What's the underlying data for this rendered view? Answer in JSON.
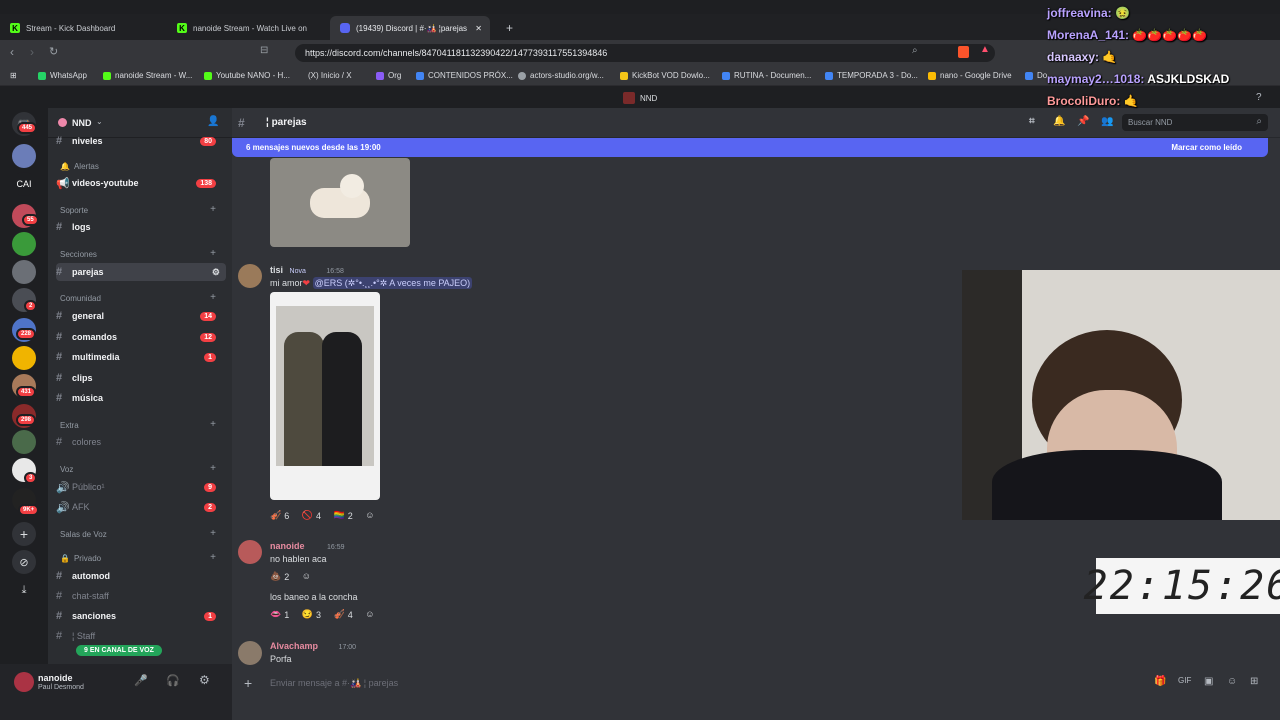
{
  "browser": {
    "tabs": [
      {
        "title": "Stream - Kick Dashboard"
      },
      {
        "title": "nanoide Stream - Watch Live on"
      },
      {
        "title": "(19439) Discord | #·🎎 ¦parejas"
      }
    ],
    "url": "https://discord.com/channels/847041181132390422/1477393117551394846",
    "bookmarks": [
      "WhatsApp",
      "nanoide Stream - W...",
      "Youtube NANO - H...",
      "(X) Inicio / X",
      "Org",
      "CONTENIDOS PRÓX...",
      "actors-studio.org/w...",
      "KickBot VOD Dowlo...",
      "RUTINA - Documen...",
      "TEMPORADA 3 - Do...",
      "nano - Google Drive",
      "Do..."
    ]
  },
  "top_strip": {
    "label": "NND"
  },
  "server_badges": {
    "first": "445",
    "b65": "55",
    "b2": "2",
    "b228": "228",
    "b431": "431",
    "b298": "298",
    "b3": "3",
    "b9k": "9K+",
    "cai": "CAI"
  },
  "guild": {
    "name": "NND",
    "search_placeholder": "Buscar NND"
  },
  "channels": {
    "niveles": {
      "name": "niveles",
      "badge": "80"
    },
    "alertas": "Alertas",
    "videos": {
      "name": "videos-youtube",
      "badge": "138"
    },
    "soporte": "Soporte",
    "logs": "logs",
    "secciones": "Secciones",
    "parejas": "parejas",
    "comunidad": "Comunidad",
    "general": {
      "name": "general",
      "badge": "14"
    },
    "comandos": {
      "name": "comandos",
      "badge": "12"
    },
    "multimedia": {
      "name": "multimedia",
      "badge": "1"
    },
    "clips": "clips",
    "musica": "música",
    "extra": "Extra",
    "colores": "colores",
    "voz": "Voz",
    "publico": {
      "name": "Público¹",
      "badge": "9"
    },
    "afk": {
      "name": "AFK",
      "badge": "2"
    },
    "salas": "Salas de Voz",
    "privado": "Privado",
    "automod": "automod",
    "chatstaff": "chat-staff",
    "sanciones": {
      "name": "sanciones",
      "badge": "1"
    },
    "staff": "¦ Staff",
    "voice_pill": "9 EN CANAL DE VOZ"
  },
  "user": {
    "name": "nanoide",
    "status": "Paul Desmond"
  },
  "header": {
    "channel": "¦ parejas"
  },
  "newbar": {
    "text": "6 mensajes nuevos desde las 19:00",
    "action": "Marcar como leído"
  },
  "messages": [
    {
      "author": "tisi",
      "tag": "Nova",
      "time": "16:58",
      "text": "mi amor",
      "mention": "@ERS (✲°•.¸¸.•°✲ A veces me PAJEO)",
      "reactions": [
        {
          "emoji": "🎻",
          "count": "6"
        },
        {
          "emoji": "🚫",
          "count": "4"
        },
        {
          "emoji": "🏳️‍🌈",
          "count": "2"
        }
      ]
    },
    {
      "author": "nanoide",
      "time": "16:59",
      "text": "no hablen aca",
      "reactions": [
        {
          "emoji": "💩",
          "count": "2"
        }
      ]
    },
    {
      "author": "",
      "time": "",
      "text": "los baneo a la concha",
      "reactions": [
        {
          "emoji": "👄",
          "count": "1"
        },
        {
          "emoji": "😏",
          "count": "3"
        },
        {
          "emoji": "🎻",
          "count": "4"
        }
      ]
    },
    {
      "author": "Alvachamp",
      "time": "17:00",
      "text": "Porfa"
    }
  ],
  "composer": {
    "placeholder": "Enviar mensaje a #·🎎 ¦ parejas"
  },
  "overlay_chat": [
    {
      "user": "joffreavina:",
      "msg": "🤢"
    },
    {
      "user": "MorenaA_141:",
      "msg": "🍅🍅🍅🍅🍅"
    },
    {
      "user": "danaaxy:",
      "msg": "🤙"
    },
    {
      "user": "maymay2…1018:",
      "msg": "ASJKLDSKAD"
    },
    {
      "user": "BrocoliDuro:",
      "msg": "🤙"
    }
  ],
  "clock": "22:15:26",
  "colors": {
    "blurple": "#5865f2",
    "red_badge": "#f23f43",
    "green": "#23a55a",
    "kick": "#53fc18"
  }
}
